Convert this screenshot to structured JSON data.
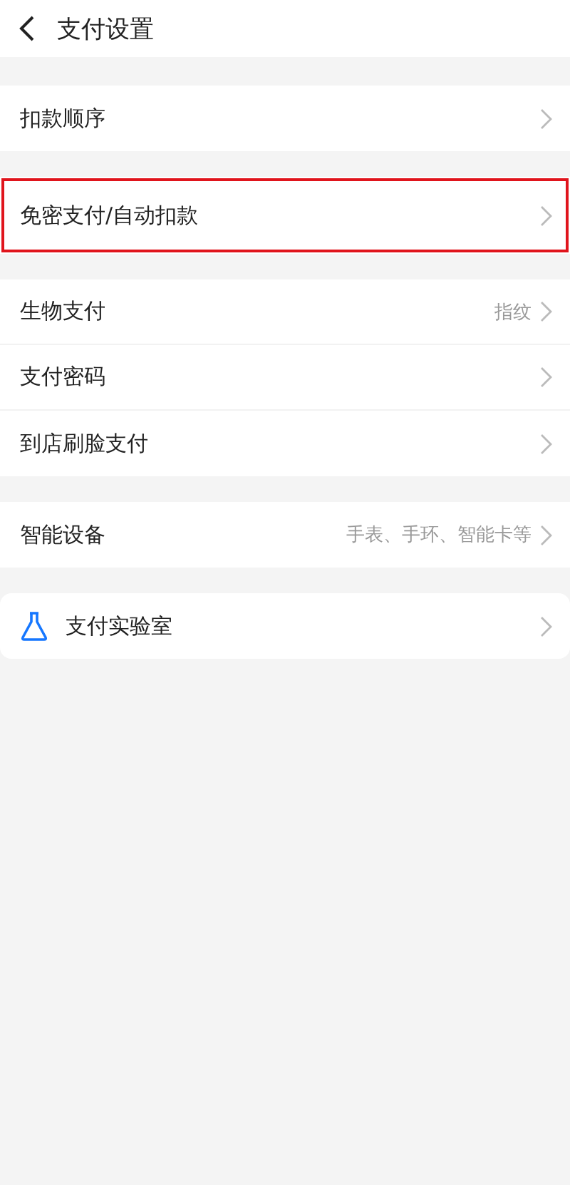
{
  "header": {
    "title": "支付设置"
  },
  "sections": [
    {
      "rows": [
        {
          "kind": "plain",
          "label": "扣款顺序",
          "highlighted": false
        }
      ]
    },
    {
      "rows": [
        {
          "kind": "plain",
          "label": "免密支付/自动扣款",
          "highlighted": true
        }
      ]
    },
    {
      "rows": [
        {
          "kind": "plain",
          "label": "生物支付",
          "value": "指纹",
          "highlighted": false
        },
        {
          "kind": "plain",
          "label": "支付密码",
          "highlighted": false
        },
        {
          "kind": "plain",
          "label": "到店刷脸支付",
          "highlighted": false
        }
      ]
    },
    {
      "rows": [
        {
          "kind": "plain",
          "label": "智能设备",
          "value": "手表、手环、智能卡等",
          "highlighted": false
        }
      ]
    },
    {
      "rows": [
        {
          "kind": "with-icon",
          "label": "支付实验室",
          "highlighted": false
        }
      ]
    }
  ]
}
